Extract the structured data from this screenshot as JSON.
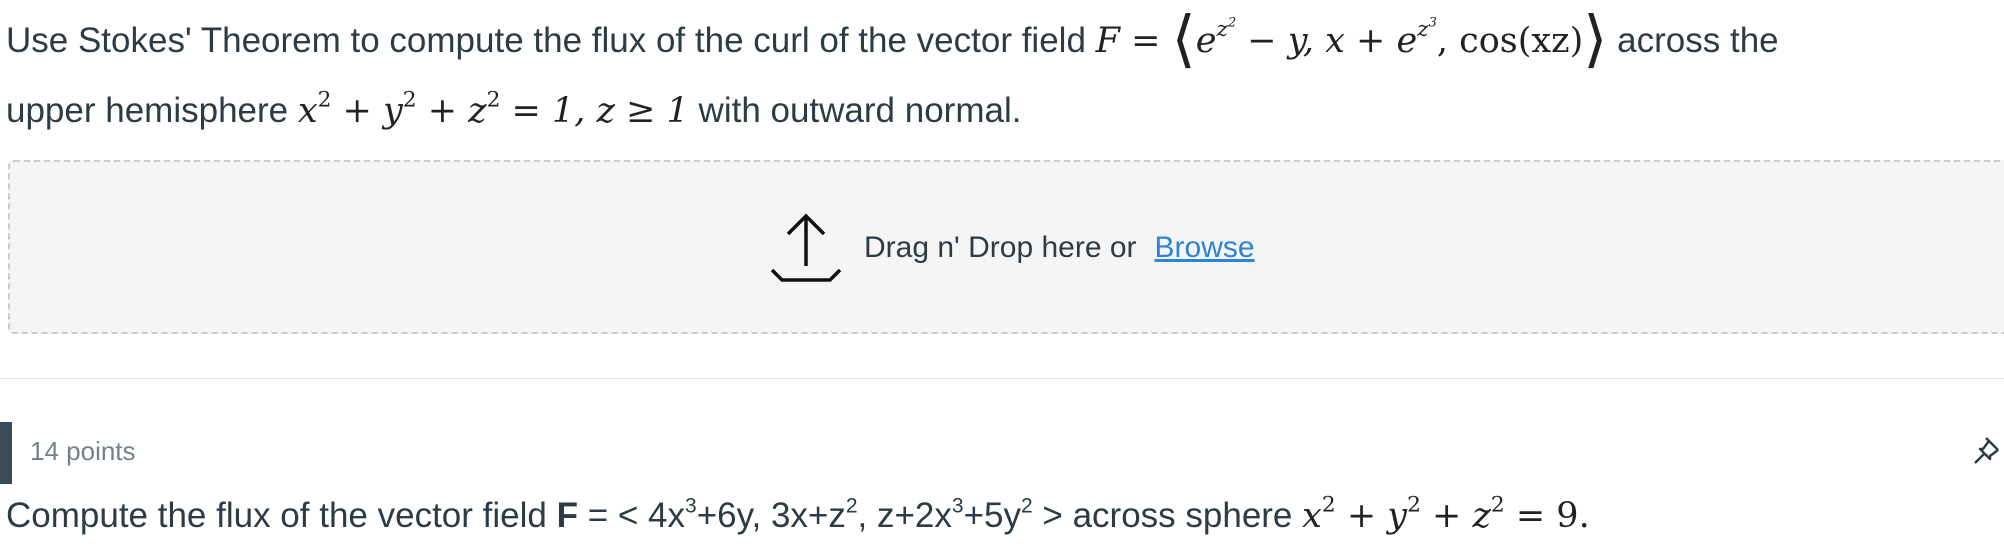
{
  "question1": {
    "text_before": "Use Stokes' Theorem to compute the flux of the curl of the vector field ",
    "math_F": "F",
    "math_eq": " = ",
    "langle": "⟨",
    "e1": "e",
    "e1_exp_base": "z",
    "e1_exp_exp": "2",
    "minus_y": " − y, x + ",
    "e2": "e",
    "e2_exp_base": "z",
    "e2_exp_exp": "3",
    "cos_part": ", cos(xz)",
    "rangle": "⟩",
    "text_across": " across the",
    "text_upper": "upper hemisphere ",
    "sphere_x": "x",
    "sphere_x_exp": "2",
    "sphere_plus_y": " + y",
    "sphere_y_exp": "2",
    "sphere_plus_z": " + z",
    "sphere_z_exp": "2",
    "sphere_rest": " = 1, z ≥ 1",
    "text_end": " with outward normal."
  },
  "dropzone": {
    "label": "Drag n' Drop here or",
    "browse_label": "Browse",
    "icon": "upload-icon"
  },
  "question2": {
    "points": "14 points",
    "text_before": "Compute the flux of the vector field ",
    "bold_F": "F",
    "field_a": " = < 4x",
    "field_a_exp": "3",
    "field_b": "+6y, 3x+z",
    "field_b_exp": "2",
    "field_c": ",  z+2x",
    "field_c_exp": "3",
    "field_d": "+5y",
    "field_d_exp": "2",
    "field_e": " > across sphere ",
    "sphere_x": "x",
    "sphere_x_exp": "2",
    "sphere_plus_y": " + y",
    "sphere_y_exp": "2",
    "sphere_plus_z": " + z",
    "sphere_z_exp": "2",
    "sphere_rest": " = 9.",
    "pin_icon": "pin-icon"
  },
  "colors": {
    "text": "#2d3b45",
    "link": "#2d83d6",
    "muted": "#73818c",
    "dropzone_bg": "#f5f5f5",
    "dropzone_border": "#c7cdd1",
    "accent_bar": "#394b58"
  }
}
